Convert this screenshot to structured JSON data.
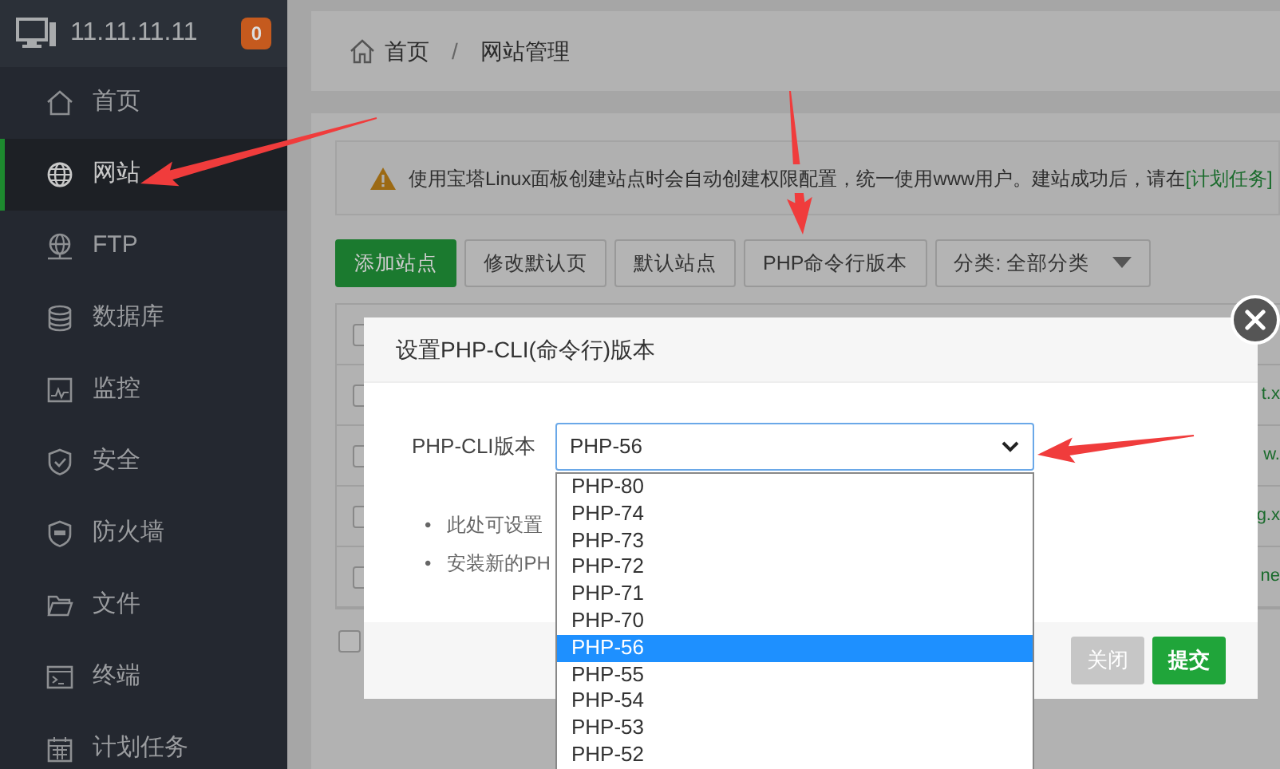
{
  "sidebar": {
    "host": "11.11.11.11",
    "badge": "0",
    "items": [
      {
        "label": "首页",
        "selected": false
      },
      {
        "label": "网站",
        "selected": true
      },
      {
        "label": "FTP",
        "selected": false
      },
      {
        "label": "数据库",
        "selected": false
      },
      {
        "label": "监控",
        "selected": false
      },
      {
        "label": "安全",
        "selected": false
      },
      {
        "label": "防火墙",
        "selected": false
      },
      {
        "label": "文件",
        "selected": false
      },
      {
        "label": "终端",
        "selected": false
      },
      {
        "label": "计划任务",
        "selected": false
      }
    ]
  },
  "breadcrumb": {
    "items": [
      "首页",
      "网站管理"
    ],
    "separator": "/"
  },
  "notice": {
    "text": "使用宝塔Linux面板创建站点时会自动创建权限配置，统一使用www用户。建站成功后，请在",
    "link": "[计划任务]"
  },
  "toolbar": [
    {
      "label": "添加站点",
      "kind": "primary"
    },
    {
      "label": "修改默认页",
      "kind": "default"
    },
    {
      "label": "默认站点",
      "kind": "default"
    },
    {
      "label": "PHP命令行版本",
      "kind": "default"
    },
    {
      "label": "分类: 全部分类",
      "kind": "dropdown"
    }
  ],
  "table": {
    "rows": [
      {
        "checked": false
      },
      {
        "checked": false,
        "column_2": "t.x"
      },
      {
        "checked": false,
        "column_2": "w."
      },
      {
        "checked": false,
        "column_2": "g.x"
      },
      {
        "checked": false,
        "column_2": "ne"
      }
    ],
    "footer_checked": false
  },
  "dialog": {
    "title": "设置PHP-CLI(命令行)版本",
    "field_label": "PHP-CLI版本",
    "value": "PHP-56",
    "options": [
      {
        "label": "PHP-80",
        "selected": false
      },
      {
        "label": "PHP-74",
        "selected": false
      },
      {
        "label": "PHP-73",
        "selected": false
      },
      {
        "label": "PHP-72",
        "selected": false
      },
      {
        "label": "PHP-71",
        "selected": false
      },
      {
        "label": "PHP-70",
        "selected": false
      },
      {
        "label": "PHP-56",
        "selected": true
      },
      {
        "label": "PHP-55",
        "selected": false
      },
      {
        "label": "PHP-54",
        "selected": false
      },
      {
        "label": "PHP-53",
        "selected": false
      },
      {
        "label": "PHP-52",
        "selected": false
      }
    ],
    "notes": [
      {
        "bullet": "•",
        "text": "此处可设置"
      },
      {
        "bullet": "•",
        "text": "安装新的PH"
      }
    ],
    "buttons": [
      {
        "label": "关闭",
        "kind": "secondary"
      },
      {
        "label": "提交",
        "kind": "primary"
      }
    ]
  }
}
